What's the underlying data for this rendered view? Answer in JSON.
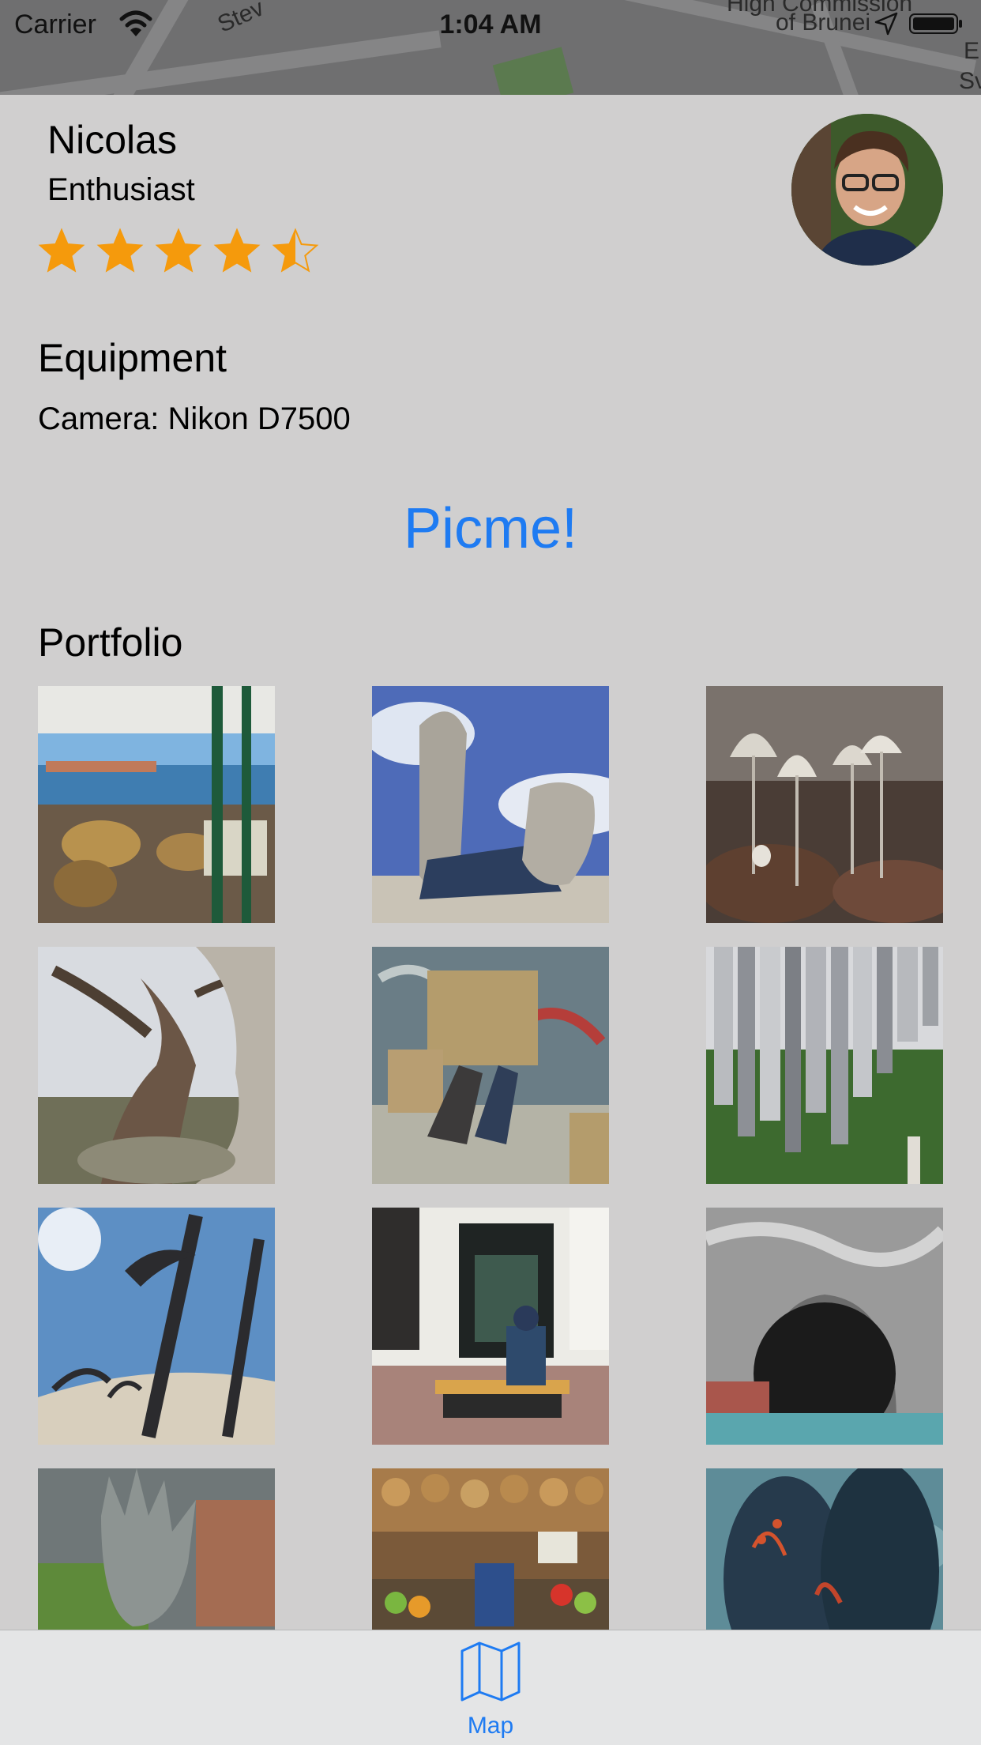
{
  "status_bar": {
    "carrier": "Carrier",
    "time": "1:04 AM",
    "icons": [
      "wifi-icon",
      "location-arrow-icon",
      "battery-icon"
    ]
  },
  "map_backdrop": {
    "labels": [
      "Stev",
      "High Commission",
      "of Brunei",
      "En",
      "Sv"
    ]
  },
  "profile": {
    "name": "Nicolas",
    "rank": "Enthusiast",
    "rating": 4.5,
    "rating_max": 5,
    "star_color": "#f59a0c"
  },
  "equipment": {
    "title": "Equipment",
    "camera": "Camera: Nikon D7500"
  },
  "picme_button": {
    "label": "Picme!",
    "color": "#1e7bf2"
  },
  "portfolio": {
    "title": "Portfolio",
    "photos": [
      "waterfront-cafe-photo",
      "boots-in-sand-photo",
      "mushrooms-photo",
      "twisted-tree-photo",
      "cardboard-box-people-photo",
      "metal-pipes-sculpture-photo",
      "anchors-in-sand-photo",
      "man-on-bench-photo",
      "sea-cave-photo",
      "hand-on-wall-photo",
      "market-stall-photo",
      "hot-air-balloons-photo"
    ]
  },
  "tab_bar": {
    "items": [
      {
        "label": "Map",
        "icon": "map-icon",
        "active_color": "#1e7bf2"
      }
    ]
  }
}
